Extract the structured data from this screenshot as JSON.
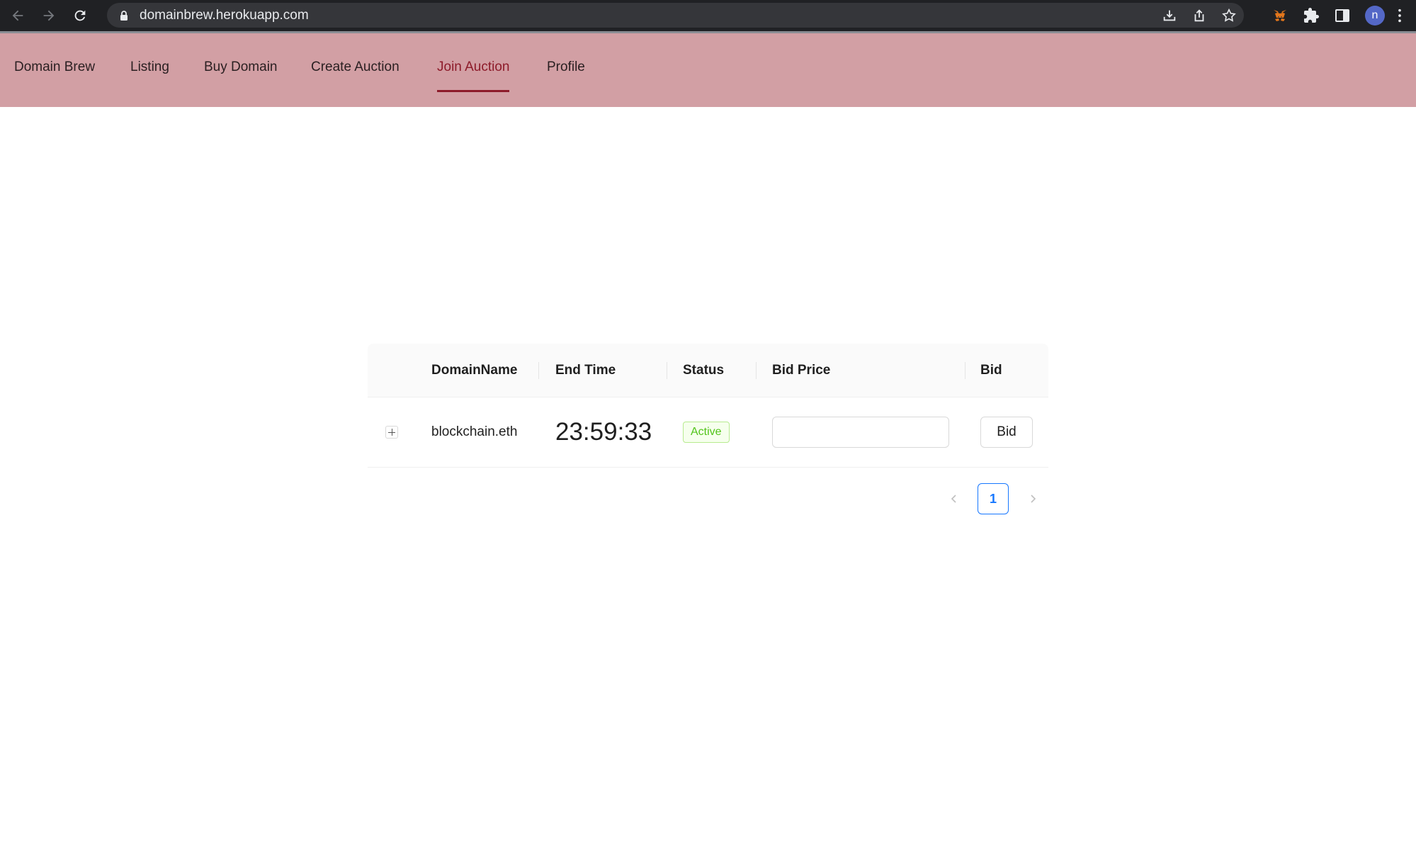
{
  "browser": {
    "url": "domainbrew.herokuapp.com",
    "avatar_letter": "n",
    "icons": [
      "back-arrow-icon",
      "forward-arrow-icon",
      "reload-icon",
      "lock-icon",
      "install-icon",
      "share-icon",
      "star-icon",
      "metamask-fox-icon",
      "puzzle-icon",
      "side-panel-icon",
      "kebab-menu-icon"
    ]
  },
  "navbar": {
    "background": "#d29fa4",
    "active_color": "#8d1b2a",
    "items": [
      {
        "label": "Domain Brew"
      },
      {
        "label": "Listing"
      },
      {
        "label": "Buy Domain"
      },
      {
        "label": "Create Auction"
      },
      {
        "label": "Join Auction",
        "active": true
      },
      {
        "label": "Profile"
      }
    ]
  },
  "table": {
    "headers": [
      "DomainName",
      "End Time",
      "Status",
      "Bid Price",
      "Bid"
    ],
    "rows": [
      {
        "domain": "blockchain.eth",
        "end_time": "23:59:33",
        "status": "Active",
        "bid_price": "",
        "bid_button": "Bid"
      }
    ]
  },
  "pagination": {
    "current_page": "1"
  }
}
